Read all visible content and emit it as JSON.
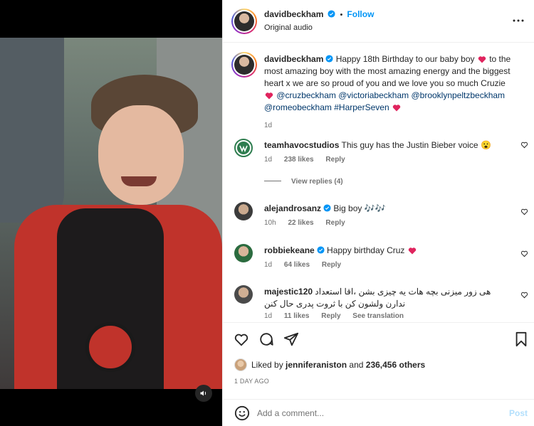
{
  "header": {
    "username": "davidbeckham",
    "separator": "•",
    "follow_label": "Follow",
    "audio": "Original audio"
  },
  "caption": {
    "username": "davidbeckham",
    "text_1": "Happy 18th Birthday to our baby boy",
    "text_2": "to the most amazing boy with the most amazing energy and the biggest heart x we are so proud of you and we love you so much Cruzie",
    "mentions": [
      "@cruzbeckham",
      "@victoriabeckham",
      "@brooklynpeltzbeckham",
      "@romeobeckham",
      "#HarperSeven"
    ],
    "time": "1d"
  },
  "comments": [
    {
      "username": "teamhavocstudios",
      "text": "This guy has the Justin Bieber voice",
      "emoji": "😮",
      "time": "1d",
      "likes": "238 likes",
      "reply": "Reply",
      "view_replies": "View replies (4)"
    },
    {
      "username": "alejandrosanz",
      "text": "Big boy",
      "emoji": "🎶🎶",
      "time": "10h",
      "likes": "22 likes",
      "reply": "Reply"
    },
    {
      "username": "robbiekeane",
      "text": "Happy birthday Cruz",
      "time": "1d",
      "likes": "64 likes",
      "reply": "Reply"
    },
    {
      "username": "majestic120",
      "text_line1": "هی زور میزنی بچه هات یه چیزی بشن ،اقا استعداد",
      "text_line2": "ندارن ولشون کن با ثروت پدری حال کنن",
      "time": "1d",
      "likes": "11 likes",
      "reply": "Reply",
      "translation": "See translation"
    }
  ],
  "likes_line": {
    "prefix": "Liked by",
    "user": "jenniferaniston",
    "middle": "and",
    "count": "236,456 others"
  },
  "timestamp": "1 DAY AGO",
  "add_comment": {
    "placeholder": "Add a comment...",
    "post_label": "Post"
  },
  "colors": {
    "link": "#0095f6",
    "mention": "#00376b",
    "heart": "#ed4956",
    "muted": "#737373"
  },
  "icons": [
    "verified-badge-icon",
    "more-options-icon",
    "heart-icon",
    "comment-icon",
    "share-icon",
    "bookmark-icon",
    "emoji-icon",
    "sound-icon"
  ]
}
